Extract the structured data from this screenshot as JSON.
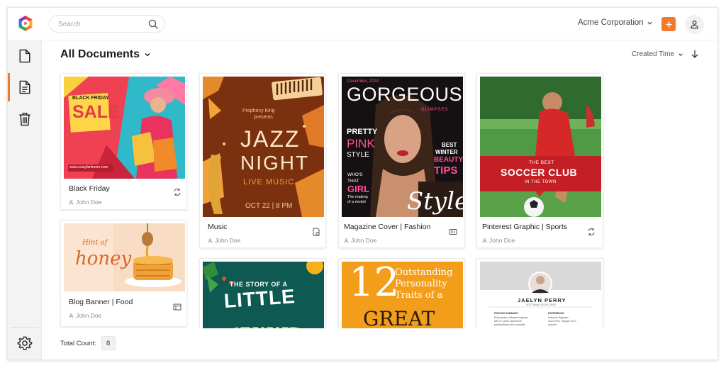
{
  "header": {
    "search_placeholder": "Search",
    "organization": "Acme Corporation"
  },
  "main": {
    "title": "All Documents",
    "sort_label": "Created Time"
  },
  "documents": [
    {
      "name": "Black Friday",
      "owner": "John Doe",
      "type_icon": "template-sync-icon",
      "thumb": {
        "tag": "BLACK FRIDAY",
        "headline": "SALE",
        "url": "www.crazyfanlroom.com"
      }
    },
    {
      "name": "Music",
      "owner": "John Doe",
      "type_icon": "document-badge-icon",
      "thumb": {
        "presenter": "Prophecy King",
        "presents": "presents",
        "line1": "JAZZ",
        "line2": "NIGHT",
        "line3": "LIVE MUSIC",
        "date": "OCT 22 | 8 PM"
      }
    },
    {
      "name": "Magazine Cover | Fashion",
      "owner": "John Doe",
      "type_icon": "id-card-icon",
      "thumb": {
        "issue": "December, 2024",
        "masthead": "GORGEOUS",
        "strap": "GLIMPSES",
        "pretty": "PRETTY",
        "pink": "PINK",
        "style_word": "STYLE",
        "best": "BEST",
        "winter": "WINTER",
        "beauty": "BEAUTY",
        "tips": "TIPS",
        "whos": "WHO'S",
        "that": "THAT",
        "girl": "GIRL",
        "making1": "The making",
        "making2": "of a model",
        "script": "Style"
      }
    },
    {
      "name": "Pinterest Graphic | Sports",
      "owner": "John Doe",
      "type_icon": "template-sync-icon",
      "thumb": {
        "pre": "THE BEST",
        "headline": "SOCCER CLUB",
        "post": "IN THE TOWN"
      }
    },
    {
      "name": "Blog Banner | Food",
      "owner": "John Doe",
      "type_icon": "banner-layout-icon",
      "thumb": {
        "hint": "Hint of",
        "headline": "honey"
      }
    },
    {
      "name": "",
      "owner": "",
      "thumb": {
        "line1": "THE STORY OF A",
        "line2": "LITTLE",
        "line3": "FROG"
      }
    },
    {
      "name": "",
      "owner": "",
      "thumb": {
        "number": "12",
        "line1": "Outstanding",
        "line2": "Personality",
        "line3": "Traits of a",
        "headline": "GREAT"
      }
    },
    {
      "name": "",
      "owner": "",
      "thumb": {
        "person": "JAELYN PERRY",
        "role": "SOFTWARE DEVELOPER",
        "sec1": "PROFILE SUMMARY",
        "sec2": "EXPERIENCE",
        "p1": "Enthusiastic software engineer",
        "p2": "with 5+ years experience",
        "p3": "participating in the complete",
        "e1": "Software Engineer",
        "e2": "Cloud Firm / August 2017 -",
        "e3": "present"
      }
    }
  ],
  "footer": {
    "total_label": "Total Count:",
    "total_value": "8"
  },
  "colors": {
    "accent": "#f2792a",
    "sidebar_bg": "#f3f3f3"
  },
  "icons": {
    "sidebar": [
      "file-icon",
      "document-text-icon",
      "trash-icon",
      "settings-icon"
    ],
    "header": [
      "search-icon",
      "chevron-down-icon",
      "plus-icon",
      "user-icon"
    ]
  }
}
